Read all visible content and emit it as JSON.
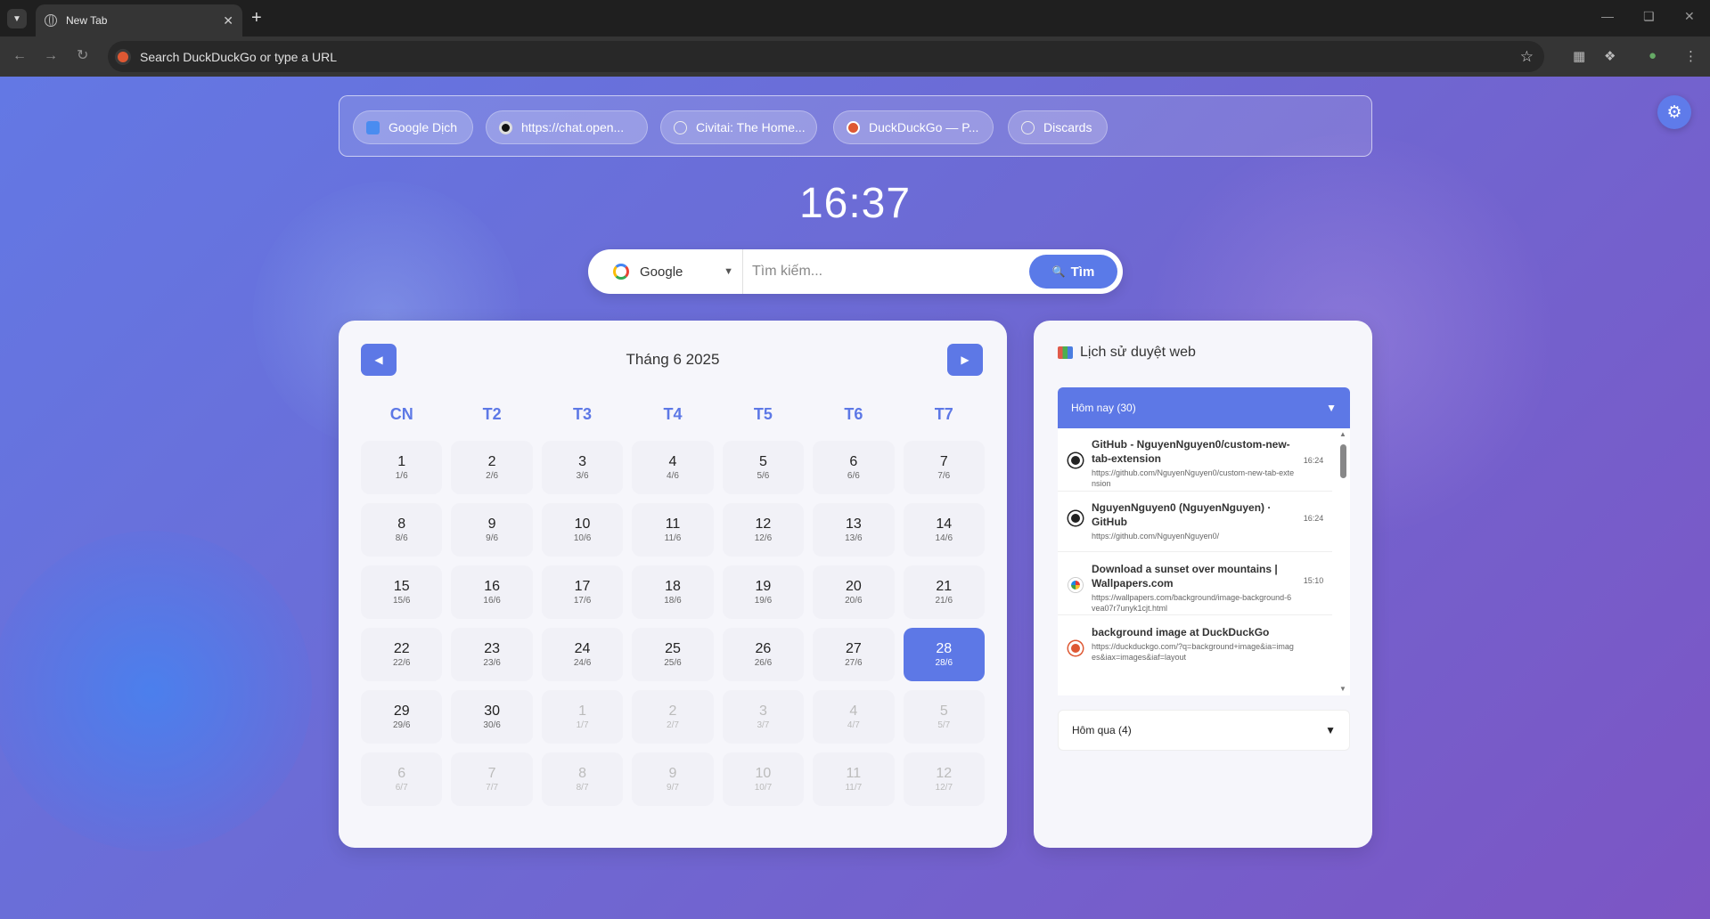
{
  "browser": {
    "tab_title": "New Tab",
    "omnibox_placeholder": "Search DuckDuckGo or type a URL"
  },
  "shortcuts": [
    {
      "label": "Google Dịch",
      "icon": "google-translate-icon"
    },
    {
      "label": "https://chat.open...",
      "icon": "openai-icon"
    },
    {
      "label": "Civitai: The Home...",
      "icon": "globe-icon"
    },
    {
      "label": "DuckDuckGo — P...",
      "icon": "duckduckgo-icon"
    },
    {
      "label": "Discards",
      "icon": "globe-icon"
    }
  ],
  "clock": "16:37",
  "search": {
    "engine": "Google",
    "placeholder": "Tìm kiếm...",
    "button_label": "Tìm"
  },
  "calendar": {
    "title": "Tháng 6 2025",
    "weekdays": [
      "CN",
      "T2",
      "T3",
      "T4",
      "T5",
      "T6",
      "T7"
    ],
    "days": [
      {
        "n": "1",
        "s": "1/6"
      },
      {
        "n": "2",
        "s": "2/6"
      },
      {
        "n": "3",
        "s": "3/6"
      },
      {
        "n": "4",
        "s": "4/6"
      },
      {
        "n": "5",
        "s": "5/6"
      },
      {
        "n": "6",
        "s": "6/6"
      },
      {
        "n": "7",
        "s": "7/6"
      },
      {
        "n": "8",
        "s": "8/6"
      },
      {
        "n": "9",
        "s": "9/6"
      },
      {
        "n": "10",
        "s": "10/6"
      },
      {
        "n": "11",
        "s": "11/6"
      },
      {
        "n": "12",
        "s": "12/6"
      },
      {
        "n": "13",
        "s": "13/6"
      },
      {
        "n": "14",
        "s": "14/6"
      },
      {
        "n": "15",
        "s": "15/6"
      },
      {
        "n": "16",
        "s": "16/6"
      },
      {
        "n": "17",
        "s": "17/6"
      },
      {
        "n": "18",
        "s": "18/6"
      },
      {
        "n": "19",
        "s": "19/6"
      },
      {
        "n": "20",
        "s": "20/6"
      },
      {
        "n": "21",
        "s": "21/6"
      },
      {
        "n": "22",
        "s": "22/6"
      },
      {
        "n": "23",
        "s": "23/6"
      },
      {
        "n": "24",
        "s": "24/6"
      },
      {
        "n": "25",
        "s": "25/6"
      },
      {
        "n": "26",
        "s": "26/6"
      },
      {
        "n": "27",
        "s": "27/6"
      },
      {
        "n": "28",
        "s": "28/6",
        "today": true
      },
      {
        "n": "29",
        "s": "29/6"
      },
      {
        "n": "30",
        "s": "30/6"
      },
      {
        "n": "1",
        "s": "1/7",
        "other": true
      },
      {
        "n": "2",
        "s": "2/7",
        "other": true
      },
      {
        "n": "3",
        "s": "3/7",
        "other": true
      },
      {
        "n": "4",
        "s": "4/7",
        "other": true
      },
      {
        "n": "5",
        "s": "5/7",
        "other": true
      },
      {
        "n": "6",
        "s": "6/7",
        "other": true
      },
      {
        "n": "7",
        "s": "7/7",
        "other": true
      },
      {
        "n": "8",
        "s": "8/7",
        "other": true
      },
      {
        "n": "9",
        "s": "9/7",
        "other": true
      },
      {
        "n": "10",
        "s": "10/7",
        "other": true
      },
      {
        "n": "11",
        "s": "11/7",
        "other": true
      },
      {
        "n": "12",
        "s": "12/7",
        "other": true
      }
    ]
  },
  "history": {
    "title": "Lịch sử duyệt web",
    "today_group": "Hôm nay (30)",
    "yesterday_group": "Hôm qua (4)",
    "items": [
      {
        "title": "GitHub - NguyenNguyen0/custom-new-tab-extension",
        "url": "https://github.com/NguyenNguyen0/custom-new-tab-extension",
        "time": "16:24",
        "icon": "github-icon"
      },
      {
        "title": "NguyenNguyen0 (NguyenNguyen) · GitHub",
        "url": "https://github.com/NguyenNguyen0/",
        "time": "16:24",
        "icon": "github-icon"
      },
      {
        "title": "Download a sunset over mountains | Wallpapers.com",
        "url": "https://wallpapers.com/background/image-background-6vea07r7unyk1cjt.html",
        "time": "15:10",
        "icon": "wallpapers-icon"
      },
      {
        "title": "background image at DuckDuckGo",
        "url": "https://duckduckgo.com/?q=background+image&ia=images&iax=images&iaf=layout",
        "time": "",
        "icon": "duckduckgo-icon"
      }
    ]
  },
  "colors": {
    "accent": "#5d78e6",
    "panel": "#f6f6fb"
  }
}
